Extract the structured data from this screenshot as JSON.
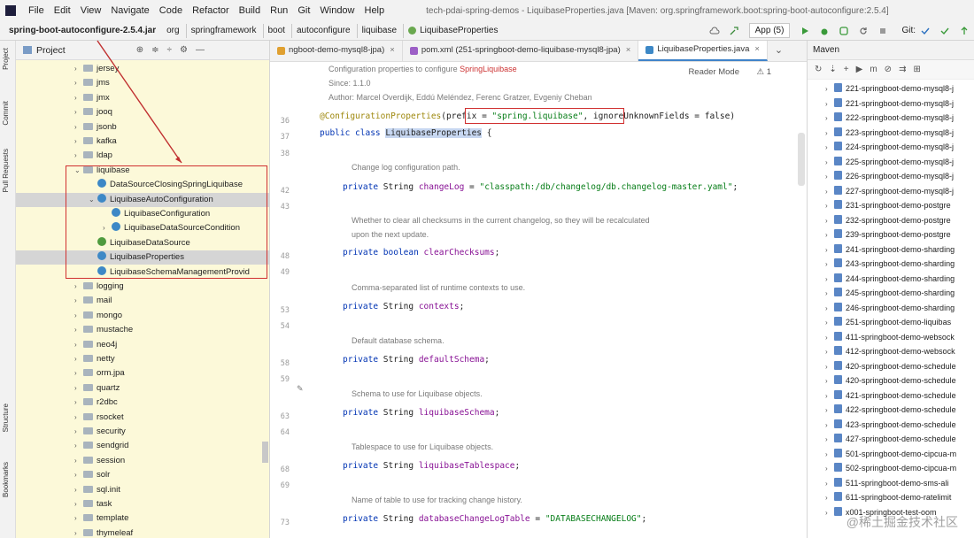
{
  "menubar": {
    "items": [
      "File",
      "Edit",
      "View",
      "Navigate",
      "Code",
      "Refactor",
      "Build",
      "Run",
      "Git",
      "Window",
      "Help"
    ],
    "window_title": "tech-pdai-spring-demos - LiquibaseProperties.java [Maven: org.springframework.boot:spring-boot-autoconfigure:2.5.4]"
  },
  "navbar": {
    "crumbs": [
      "spring-boot-autoconfigure-2.5.4.jar",
      "org",
      "springframework",
      "boot",
      "autoconfigure",
      "liquibase",
      "LiquibaseProperties"
    ],
    "run_config": "App (5)",
    "git_label": "Git:"
  },
  "left_stripe": [
    "Project",
    "Commit",
    "Pull Requests",
    "Structure",
    "Bookmarks"
  ],
  "project": {
    "title": "Project",
    "rows": [
      {
        "label": "jersey",
        "kind": "folder",
        "arrow": "›",
        "indent": 0
      },
      {
        "label": "jms",
        "kind": "folder",
        "arrow": "›",
        "indent": 0
      },
      {
        "label": "jmx",
        "kind": "folder",
        "arrow": "›",
        "indent": 0
      },
      {
        "label": "jooq",
        "kind": "folder",
        "arrow": "›",
        "indent": 0
      },
      {
        "label": "jsonb",
        "kind": "folder",
        "arrow": "›",
        "indent": 0
      },
      {
        "label": "kafka",
        "kind": "folder",
        "arrow": "›",
        "indent": 0
      },
      {
        "label": "ldap",
        "kind": "folder",
        "arrow": "›",
        "indent": 0
      },
      {
        "label": "liquibase",
        "kind": "folder",
        "arrow": "⌄",
        "indent": 0
      },
      {
        "label": "DataSourceClosingSpringLiquibase",
        "kind": "class",
        "arrow": "",
        "indent": 1
      },
      {
        "label": "LiquibaseAutoConfiguration",
        "kind": "class",
        "arrow": "⌄",
        "indent": 1,
        "selected": true
      },
      {
        "label": "LiquibaseConfiguration",
        "kind": "class",
        "arrow": "",
        "indent": 2
      },
      {
        "label": "LiquibaseDataSourceCondition",
        "kind": "class",
        "arrow": "›",
        "indent": 2
      },
      {
        "label": "LiquibaseDataSource",
        "kind": "class-green",
        "arrow": "",
        "indent": 1
      },
      {
        "label": "LiquibaseProperties",
        "kind": "class",
        "arrow": "",
        "indent": 1,
        "selected": true
      },
      {
        "label": "LiquibaseSchemaManagementProvid",
        "kind": "class",
        "arrow": "",
        "indent": 1
      },
      {
        "label": "logging",
        "kind": "folder",
        "arrow": "›",
        "indent": 0
      },
      {
        "label": "mail",
        "kind": "folder",
        "arrow": "›",
        "indent": 0
      },
      {
        "label": "mongo",
        "kind": "folder",
        "arrow": "›",
        "indent": 0
      },
      {
        "label": "mustache",
        "kind": "folder",
        "arrow": "›",
        "indent": 0
      },
      {
        "label": "neo4j",
        "kind": "folder",
        "arrow": "›",
        "indent": 0
      },
      {
        "label": "netty",
        "kind": "folder",
        "arrow": "›",
        "indent": 0
      },
      {
        "label": "orm.jpa",
        "kind": "folder",
        "arrow": "›",
        "indent": 0
      },
      {
        "label": "quartz",
        "kind": "folder",
        "arrow": "›",
        "indent": 0
      },
      {
        "label": "r2dbc",
        "kind": "folder",
        "arrow": "›",
        "indent": 0
      },
      {
        "label": "rsocket",
        "kind": "folder",
        "arrow": "›",
        "indent": 0
      },
      {
        "label": "security",
        "kind": "folder",
        "arrow": "›",
        "indent": 0
      },
      {
        "label": "sendgrid",
        "kind": "folder",
        "arrow": "›",
        "indent": 0
      },
      {
        "label": "session",
        "kind": "folder",
        "arrow": "›",
        "indent": 0
      },
      {
        "label": "solr",
        "kind": "folder",
        "arrow": "›",
        "indent": 0
      },
      {
        "label": "sql.init",
        "kind": "folder",
        "arrow": "›",
        "indent": 0
      },
      {
        "label": "task",
        "kind": "folder",
        "arrow": "›",
        "indent": 0
      },
      {
        "label": "template",
        "kind": "folder",
        "arrow": "›",
        "indent": 0
      },
      {
        "label": "thymeleaf",
        "kind": "folder",
        "arrow": "›",
        "indent": 0
      }
    ]
  },
  "editor_tabs": [
    {
      "label": "ngboot-demo-mysql8-jpa)",
      "icon_color": "#e0a030",
      "active": false
    },
    {
      "label": "pom.xml (251-springboot-demo-liquibase-mysql8-jpa)",
      "icon_color": "#9c5fc6",
      "active": false
    },
    {
      "label": "LiquibaseProperties.java",
      "icon_color": "#3d88c6",
      "active": true
    }
  ],
  "editor": {
    "reader_mode": "Reader Mode",
    "warn_count": "1",
    "header_doc": [
      {
        "text": "Configuration properties to configure ",
        "red": "SpringLiquibase"
      },
      {
        "text": "Since:    1.1.0",
        "red": ""
      },
      {
        "text": "Author: Marcel Overdijk, Eddú Meléndez, Ferenc Gratzer, Evgeniy Cheban",
        "red": ""
      }
    ],
    "line_numbers": [
      "36",
      "37",
      "38",
      "42",
      "43",
      "48",
      "49",
      "53",
      "54",
      "58",
      "59",
      "63",
      "64",
      "68",
      "69",
      "73"
    ],
    "code_36": {
      "ann": "@ConfigurationProperties",
      "open": "(",
      "prefix_key": "prefix",
      "eq": " = ",
      "prefix_val": "\"spring.liquibase\"",
      "rest": ", ignoreUnknownFields = false)"
    },
    "code_37": {
      "kw": "public class ",
      "name": "LiquibaseProperties",
      "rest": " {"
    },
    "blocks": [
      {
        "doc": "Change log configuration path.",
        "type": "String",
        "field": "changeLog",
        "init": " = \"classpath:/db/changelog/db.changelog-master.yaml\";"
      },
      {
        "doc": "Whether to clear all checksums in the current changelog, so they will be recalculated",
        "doc2": "upon the next update.",
        "type": "boolean",
        "field": "clearChecksums",
        "init": ";"
      },
      {
        "doc": "Comma-separated list of runtime contexts to use.",
        "type": "String",
        "field": "contexts",
        "init": ";"
      },
      {
        "doc": "Default database schema.",
        "type": "String",
        "field": "defaultSchema",
        "init": ";"
      },
      {
        "doc": "Schema to use for Liquibase objects.",
        "type": "String",
        "field": "liquibaseSchema",
        "init": ";"
      },
      {
        "doc": "Tablespace to use for Liquibase objects.",
        "type": "String",
        "field": "liquibaseTablespace",
        "init": ";"
      },
      {
        "doc": "Name of table to use for tracking change history.",
        "type": "String",
        "field": "databaseChangeLogTable",
        "init": " = \"DATABASECHANGELOG\";"
      }
    ],
    "private_kw": "private "
  },
  "maven": {
    "title": "Maven",
    "items": [
      "221-springboot-demo-mysql8-j",
      "221-springboot-demo-mysql8-j",
      "222-springboot-demo-mysql8-j",
      "223-springboot-demo-mysql8-j",
      "224-springboot-demo-mysql8-j",
      "225-springboot-demo-mysql8-j",
      "226-springboot-demo-mysql8-j",
      "227-springboot-demo-mysql8-j",
      "231-springboot-demo-postgre",
      "232-springboot-demo-postgre",
      "239-springboot-demo-postgre",
      "241-springboot-demo-sharding",
      "243-springboot-demo-sharding",
      "244-springboot-demo-sharding",
      "245-springboot-demo-sharding",
      "246-springboot-demo-sharding",
      "251-springboot-demo-liquibas",
      "411-springboot-demo-websock",
      "412-springboot-demo-websock",
      "420-springboot-demo-schedule",
      "420-springboot-demo-schedule",
      "421-springboot-demo-schedule",
      "422-springboot-demo-schedule",
      "423-springboot-demo-schedule",
      "427-springboot-demo-schedule",
      "501-springboot-demo-cipcua-m",
      "502-springboot-demo-cipcua-m",
      "511-springboot-demo-sms-ali",
      "611-springboot-demo-ratelimit",
      "x001-springboot-test-oom"
    ]
  },
  "watermark": "@稀土掘金技术社区"
}
